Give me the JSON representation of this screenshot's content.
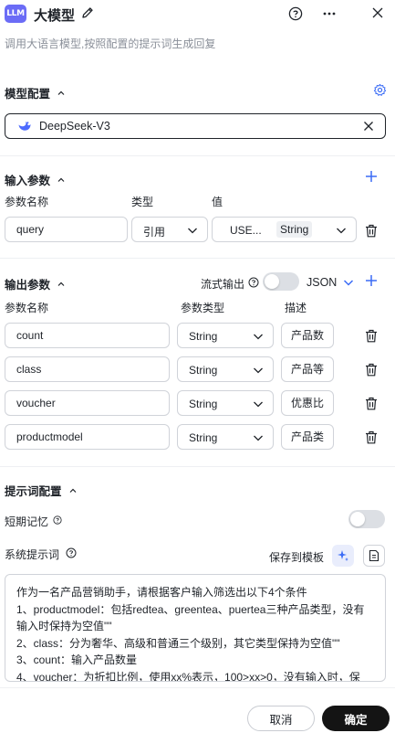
{
  "header": {
    "logo_text": "LLM",
    "title": "大模型",
    "description": "调用大语言模型,按照配置的提示词生成回复"
  },
  "model_config": {
    "section_title": "模型配置",
    "model_name": "DeepSeek-V3"
  },
  "input_params": {
    "section_title": "输入参数",
    "col_name": "参数名称",
    "col_type": "类型",
    "col_value": "值",
    "rows": [
      {
        "name": "query",
        "type": "引用",
        "value": "USE...",
        "value_type": "String"
      }
    ]
  },
  "output_params": {
    "section_title": "输出参数",
    "stream_label": "流式输出",
    "format": "JSON",
    "col_name": "参数名称",
    "col_type": "参数类型",
    "col_desc": "描述",
    "rows": [
      {
        "name": "count",
        "type": "String",
        "desc": "产品数"
      },
      {
        "name": "class",
        "type": "String",
        "desc": "产品等"
      },
      {
        "name": "voucher",
        "type": "String",
        "desc": "优惠比"
      },
      {
        "name": "productmodel",
        "type": "String",
        "desc": "产品类"
      }
    ]
  },
  "prompt_config": {
    "section_title": "提示词配置",
    "short_memory_label": "短期记忆",
    "system_prompt_label": "系统提示词",
    "save_template_label": "保存到模板",
    "prompt_lines": [
      "作为一名产品营销助手，请根据客户输入筛选出以下4个条件",
      "1、productmodel：包括redtea、greentea、puertea三种产品类型，没有输入时保持为空值\"\"",
      "2、class：分为奢华、高级和普通三个级别，其它类型保持为空值\"\"",
      "3、count：输入产品数量",
      "4、voucher：为折扣比例，使用xx%表示，100>xx>0，没有输入时，保"
    ]
  },
  "footer": {
    "cancel_label": "取消",
    "ok_label": "确定"
  },
  "colors": {
    "accent": "#3b6cf6",
    "logo_bg": "#6b6cf6",
    "primary_button": "#141414"
  }
}
